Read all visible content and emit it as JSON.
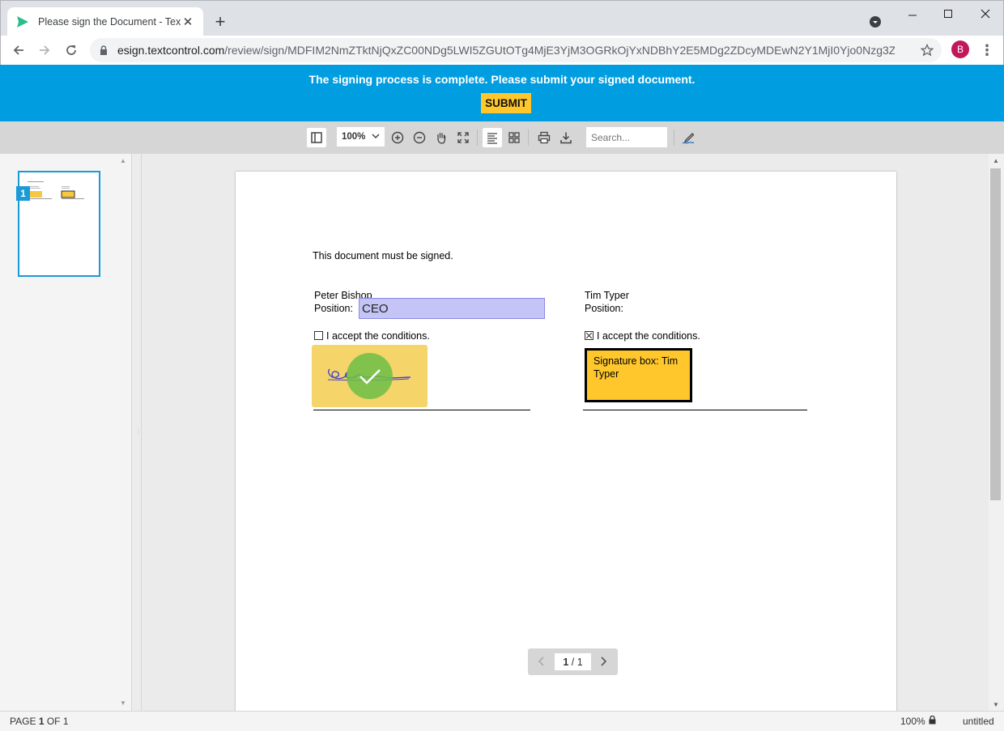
{
  "browser": {
    "tab_title": "Please sign the Document - Text",
    "url_domain": "esign.textcontrol.com",
    "url_path": "/review/sign/MDFIM2NmZTktNjQxZC00NDg5LWI5ZGUtOTg4MjE3YjM3OGRkOjYxNDBhY2E5MDg2ZDcyMDEwN2Y1MjI0Yjo0Nzg3ZTM2...",
    "profile_initial": "B"
  },
  "banner": {
    "message": "The signing process is complete. Please submit your signed document.",
    "submit_label": "SUBMIT"
  },
  "viewer_toolbar": {
    "zoom_value": "100%",
    "search_placeholder": "Search..."
  },
  "thumbnails": [
    {
      "page_number": "1"
    }
  ],
  "document": {
    "intro": "This document must be signed.",
    "left_signer": {
      "name": "Peter Bishop",
      "position_label": "Position:",
      "position_value": "CEO",
      "accept_label": "I accept the conditions.",
      "accepted": false,
      "signed": true
    },
    "right_signer": {
      "name": "Tim Typer",
      "position_label": "Position:",
      "accept_label": "I accept the conditions.",
      "accepted": true,
      "signature_box_label": "Signature box: Tim Typer"
    }
  },
  "pager": {
    "current": "1",
    "separator": "/",
    "total": "1"
  },
  "status_bar": {
    "page_prefix": "PAGE",
    "page_current": "1",
    "page_of": "OF",
    "page_total": "1",
    "zoom": "100%",
    "document_name": "untitled"
  },
  "colors": {
    "banner": "#009ee0",
    "submit": "#ffc72c",
    "signature_box": "#ffc72c",
    "signed_box": "#f5d56a",
    "form_field": "#c4c4f7",
    "thumbnail_accent": "#1a9ad6"
  }
}
